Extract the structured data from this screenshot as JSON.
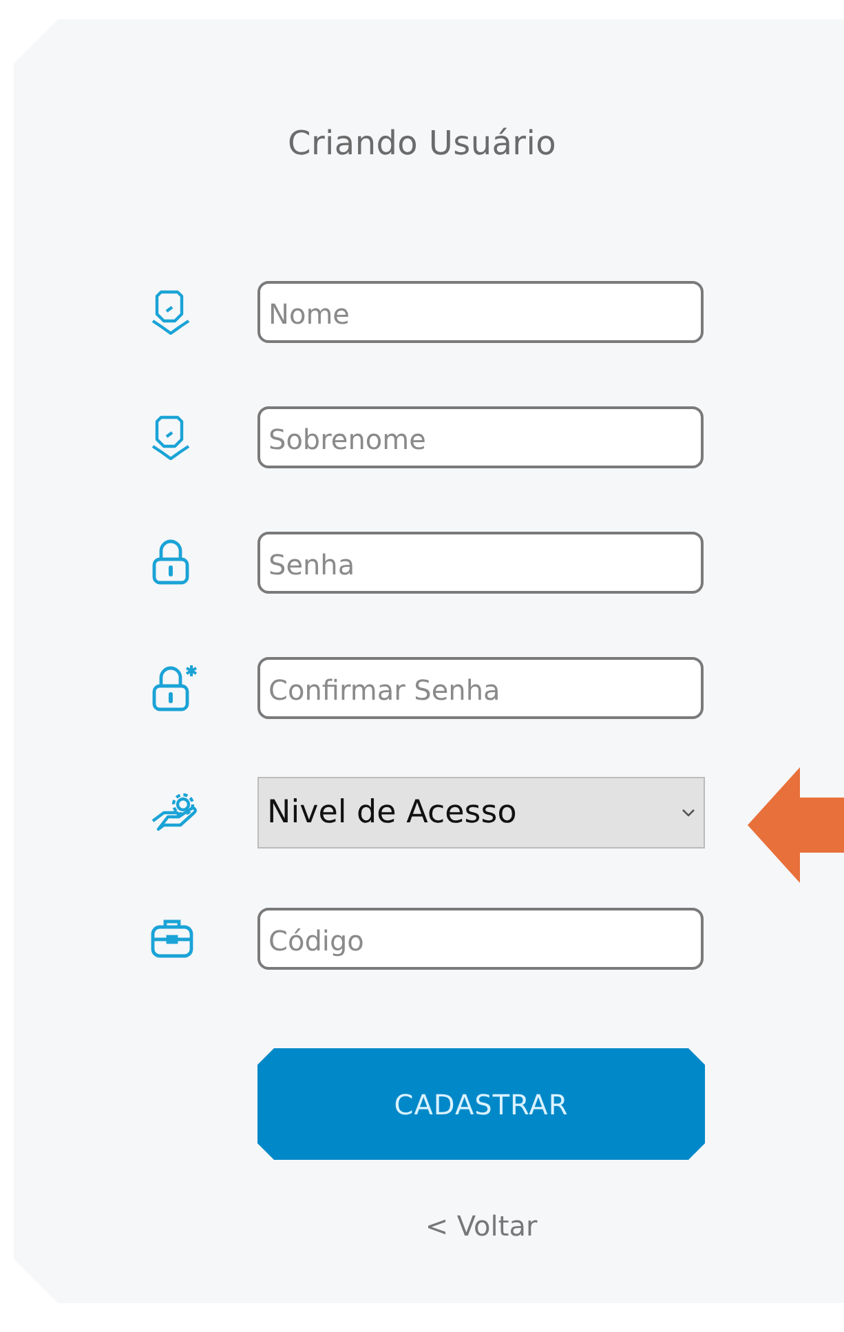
{
  "title": "Criando Usuário",
  "fields": [
    {
      "kind": "input",
      "placeholder": "Nome"
    },
    {
      "kind": "input",
      "placeholder": "Sobrenome"
    },
    {
      "kind": "input",
      "placeholder": "Senha"
    },
    {
      "kind": "input",
      "placeholder": "Confirmar Senha"
    },
    {
      "kind": "select",
      "value": "Nivel de Acesso"
    },
    {
      "kind": "input",
      "placeholder": "Código"
    }
  ],
  "submit_button": "CADASTRAR",
  "back_link": "< Voltar"
}
